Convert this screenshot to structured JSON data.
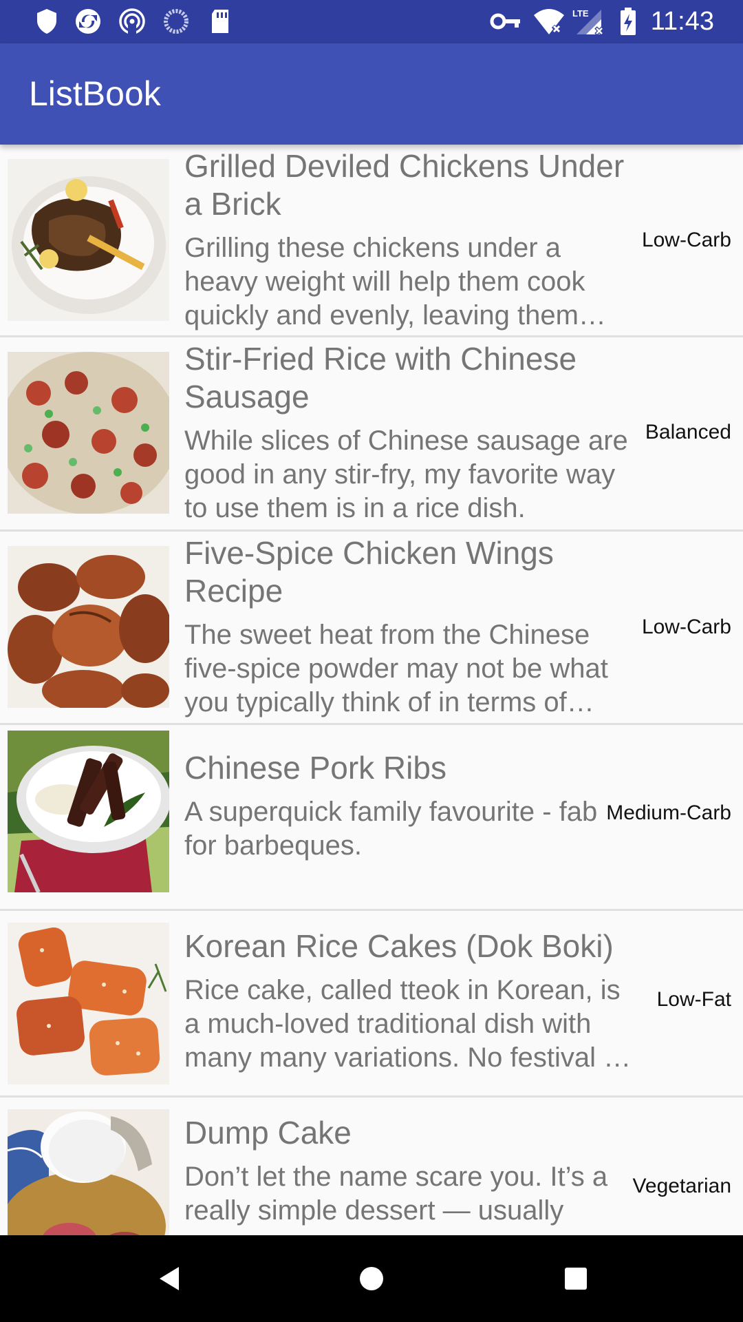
{
  "status_bar": {
    "time": "11:43",
    "icons": [
      "shield-icon",
      "sync-icon",
      "cast-icon",
      "circle-progress-icon",
      "sd-card-icon",
      "key-icon",
      "wifi-off-icon",
      "lte-signal-icon",
      "battery-charging-icon"
    ],
    "bg_color": "#303f9f"
  },
  "app_bar": {
    "title": "ListBook",
    "color": "#3f51b5"
  },
  "recipes": [
    {
      "title": "Grilled Deviled Chickens Under a Brick",
      "description": "Grilling these chickens under a heavy weight will help them cook quickly and evenly, leaving them moist and juicy inside.",
      "tag": "Low-Carb"
    },
    {
      "title": "Stir-Fried Rice with Chinese Sausage",
      "description": "While slices of Chinese sausage are good in any stir-fry, my favorite way to use them is in a rice dish.",
      "tag": "Balanced"
    },
    {
      "title": "Five-Spice Chicken Wings Recipe",
      "description": "The sweet heat from the Chinese five-spice powder may not be what you typically think of in terms of wings.",
      "tag": "Low-Carb"
    },
    {
      "title": "Chinese Pork Ribs",
      "description": "A superquick family favourite - fab for barbeques.",
      "tag": "Medium-Carb"
    },
    {
      "title": "Korean Rice Cakes (Dok Boki)",
      "description": "Rice cake, called tteok in Korean, is a much-loved traditional dish with many many variations. No festival is complete without it.",
      "tag": "Low-Fat"
    },
    {
      "title": "Dump Cake",
      "description": "Don’t let the name scare you. It’s a really simple dessert — usually",
      "tag": "Vegetarian"
    }
  ],
  "nav_bar": {
    "icons": [
      "back-icon",
      "home-icon",
      "recents-icon"
    ]
  }
}
